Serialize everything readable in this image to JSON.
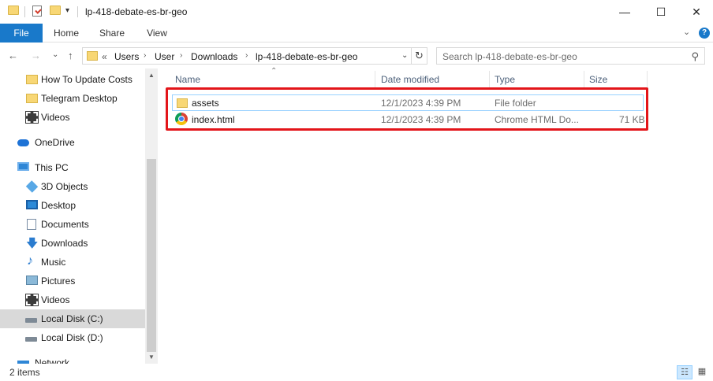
{
  "window": {
    "title": "lp-418-debate-es-br-geo",
    "qa_dropdown": "▾",
    "minimize": "—",
    "maximize": "☐",
    "close": "✕"
  },
  "ribbon": {
    "tabs": [
      "File",
      "Home",
      "Share",
      "View"
    ],
    "collapse": "⌄",
    "help": "?"
  },
  "nav": {
    "back": "←",
    "forward": "→",
    "recent": "⌄",
    "up": "↑",
    "overflow": "«",
    "breadcrumbs": [
      "Users",
      "User",
      "Downloads",
      "lp-418-debate-es-br-geo"
    ],
    "separator": "›",
    "address_dropdown": "⌄",
    "refresh": "↻"
  },
  "search": {
    "placeholder": "Search lp-418-debate-es-br-geo",
    "icon": "⚲"
  },
  "sidebar": {
    "items": [
      {
        "label": "How To Update Costs",
        "icon": "folder-icon"
      },
      {
        "label": "Telegram Desktop",
        "icon": "folder-icon"
      },
      {
        "label": "Videos",
        "icon": "video-icon"
      },
      {
        "label": "OneDrive",
        "icon": "cloud-icon"
      },
      {
        "label": "This PC",
        "icon": "computer-icon"
      },
      {
        "label": "3D Objects",
        "icon": "cube-icon"
      },
      {
        "label": "Desktop",
        "icon": "desktop-icon"
      },
      {
        "label": "Documents",
        "icon": "document-icon"
      },
      {
        "label": "Downloads",
        "icon": "download-icon"
      },
      {
        "label": "Music",
        "icon": "music-icon"
      },
      {
        "label": "Pictures",
        "icon": "picture-icon"
      },
      {
        "label": "Videos",
        "icon": "video-icon"
      },
      {
        "label": "Local Disk (C:)",
        "icon": "disk-icon"
      },
      {
        "label": "Local Disk (D:)",
        "icon": "disk-icon"
      },
      {
        "label": "Network",
        "icon": "network-icon"
      }
    ],
    "selected": "Local Disk (C:)",
    "music_glyph": "♪",
    "download_glyph": "🡇",
    "scroll_up": "▲",
    "scroll_down": "▼"
  },
  "columns": {
    "name": "Name",
    "date": "Date modified",
    "type": "Type",
    "size": "Size",
    "sort_indicator": "⌃"
  },
  "files": [
    {
      "name": "assets",
      "date": "12/1/2023 4:39 PM",
      "type": "File folder",
      "size": "",
      "icon": "folder-icon"
    },
    {
      "name": "index.html",
      "date": "12/1/2023 4:39 PM",
      "type": "Chrome HTML Do...",
      "size": "71 KB",
      "icon": "chrome-icon"
    }
  ],
  "status": {
    "item_count": "2 items",
    "details_view": "☷",
    "large_icons_view": "▦"
  },
  "colors": {
    "accent": "#1979ca",
    "highlight_border": "#e3151a",
    "selection": "#cce8ff"
  }
}
